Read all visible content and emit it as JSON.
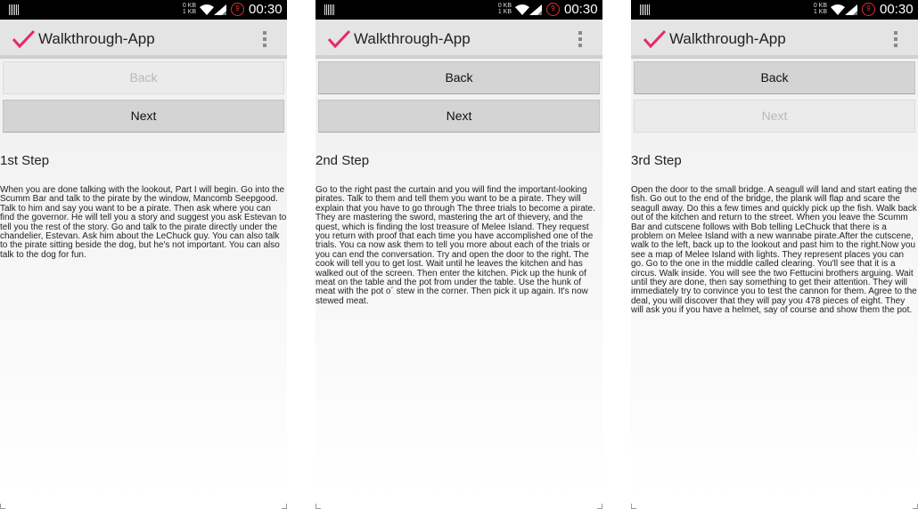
{
  "status_bar": {
    "netspeed_up": "0 KB",
    "netspeed_down": "1 KB",
    "badge": "9",
    "time": "00:30"
  },
  "app": {
    "title": "Walkthrough-App",
    "accent_color": "#e8286e"
  },
  "buttons": {
    "back_label": "Back",
    "next_label": "Next"
  },
  "screens": [
    {
      "step_title": "1st Step",
      "back_enabled": false,
      "next_enabled": true,
      "text": "When you are done talking with the lookout, Part I will begin. Go into the Scumm Bar and talk to the pirate by the window, Mancomb Seepgood. Talk to him and say you want to be a pirate. Then ask where you can find the governor. He will tell you a story and suggest you ask Estevan to tell you the rest of the story. Go and talk to the pirate directly under the chandelier, Estevan. Ask him about the LeChuck guy. You can also talk to the pirate sitting beside the dog, but he's not important. You can also talk to the dog for fun."
    },
    {
      "step_title": "2nd Step",
      "back_enabled": true,
      "next_enabled": true,
      "text": "Go to the right past the curtain and you will find the important-looking pirates. Talk to them and tell them you want to be a pirate. They will explain that you have to go through The three trials to become a pirate. They are mastering the sword, mastering the art of thievery, and the quest, which is finding the lost treasure of Melee Island. They request you return with proof that each time you have accomplished one of the trials. You ca now ask them to tell you more about each of the trials or you can end the conversation. Try and open the door to the right. The cook will tell you to get lost. Wait until he leaves the kitchen and has walked out of the screen. Then enter the kitchen. Pick up the hunk of meat on the table and the pot from under the table. Use the hunk of meat with the pot o´ stew in the corner. Then pick it up again. It's now stewed meat."
    },
    {
      "step_title": "3rd Step",
      "back_enabled": true,
      "next_enabled": false,
      "text": "Open the door to the small bridge. A seagull will land and start eating the fish. Go out to the end of the bridge, the plank will flap and scare the seagull away. Do this a few times and quickly pick up the fish. Walk back out of the kitchen and return to the street. When you leave the Scumm Bar and cutscene follows with Bob telling LeChuck that there is a problem on Melee Island with a new wannabe pirate.After the cutscene, walk to the left, back up to the lookout and past him to the right.Now you see a map of Melee Island with lights. They represent places you can go. Go to the one in the middle called clearing. You'll see that it is a circus. Walk inside. You will see the two Fettucini brothers arguing. Wait until they are done, then say something to get their attention. They will immediately try to convince you to test the cannon for them. Agree to the deal, you will discover that they will pay you 478 pieces of eight. They will ask you if you have a helmet, say of course and show them the pot."
    }
  ]
}
